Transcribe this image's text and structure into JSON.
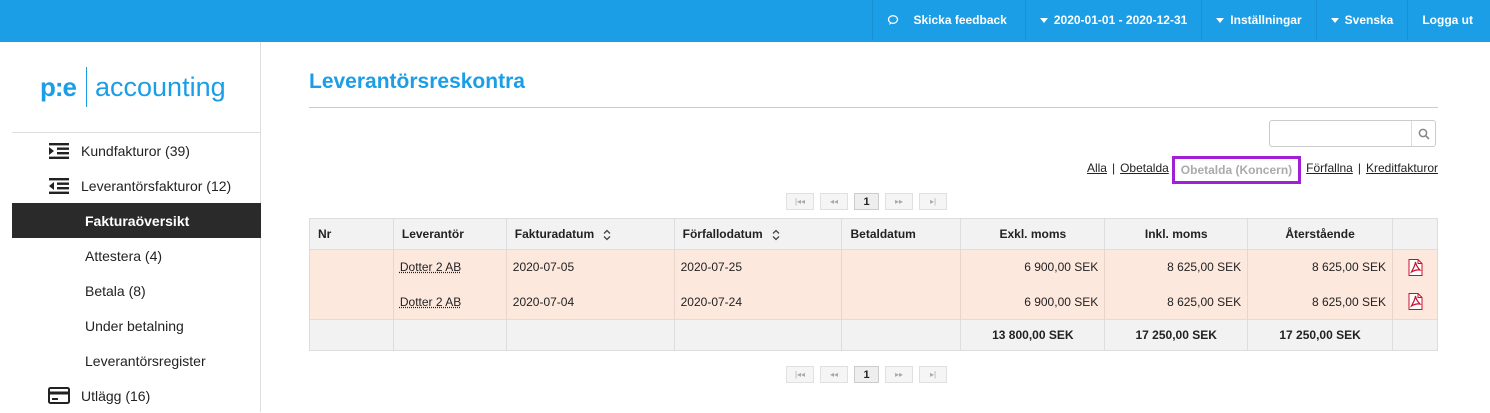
{
  "topbar": {
    "feedback": "Skicka feedback",
    "period": "2020-01-01 - 2020-12-31",
    "settings": "Inställningar",
    "language": "Svenska",
    "logout": "Logga ut"
  },
  "logo": {
    "mark": "p:e",
    "text": "accounting"
  },
  "sidebar": {
    "items": [
      {
        "label": "Kundfakturor (39)"
      },
      {
        "label": "Leverantörsfakturor (12)"
      },
      {
        "label": "Fakturaöversikt"
      },
      {
        "label": "Attestera (4)"
      },
      {
        "label": "Betala (8)"
      },
      {
        "label": "Under betalning"
      },
      {
        "label": "Leverantörsregister"
      },
      {
        "label": "Utlägg (16)"
      }
    ]
  },
  "page": {
    "title": "Leverantörsreskontra"
  },
  "search": {
    "placeholder": "",
    "value": ""
  },
  "filters": {
    "all": "Alla",
    "unpaid": "Obetalda",
    "unpaid_group": "Obetalda (Koncern)",
    "overdue": "Förfallna",
    "credit": "Kreditfakturor",
    "sep": "|"
  },
  "pager": {
    "first": "|◂◂",
    "prev": "◂◂",
    "current": "1",
    "next": "▸▸",
    "last": "▸|"
  },
  "table": {
    "headers": [
      "Nr",
      "Leverantör",
      "Fakturadatum",
      "Förfallodatum",
      "Betaldatum",
      "Exkl. moms",
      "Inkl. moms",
      "Återstående"
    ],
    "rows": [
      {
        "nr": "",
        "supplier": "Dotter 2 AB",
        "invoice_date": "2020-07-05",
        "due_date": "2020-07-25",
        "paid_date": "",
        "excl": "6 900,00 SEK",
        "incl": "8 625,00 SEK",
        "remaining": "8 625,00 SEK"
      },
      {
        "nr": "",
        "supplier": "Dotter 2 AB",
        "invoice_date": "2020-07-04",
        "due_date": "2020-07-24",
        "paid_date": "",
        "excl": "6 900,00 SEK",
        "incl": "8 625,00 SEK",
        "remaining": "8 625,00 SEK"
      }
    ],
    "totals": {
      "excl": "13 800,00 SEK",
      "incl": "17 250,00 SEK",
      "remaining": "17 250,00 SEK"
    }
  },
  "colors": {
    "brand": "#1b9ee6",
    "row_highlight": "#fde8de",
    "focus_outline": "#a020d8"
  }
}
